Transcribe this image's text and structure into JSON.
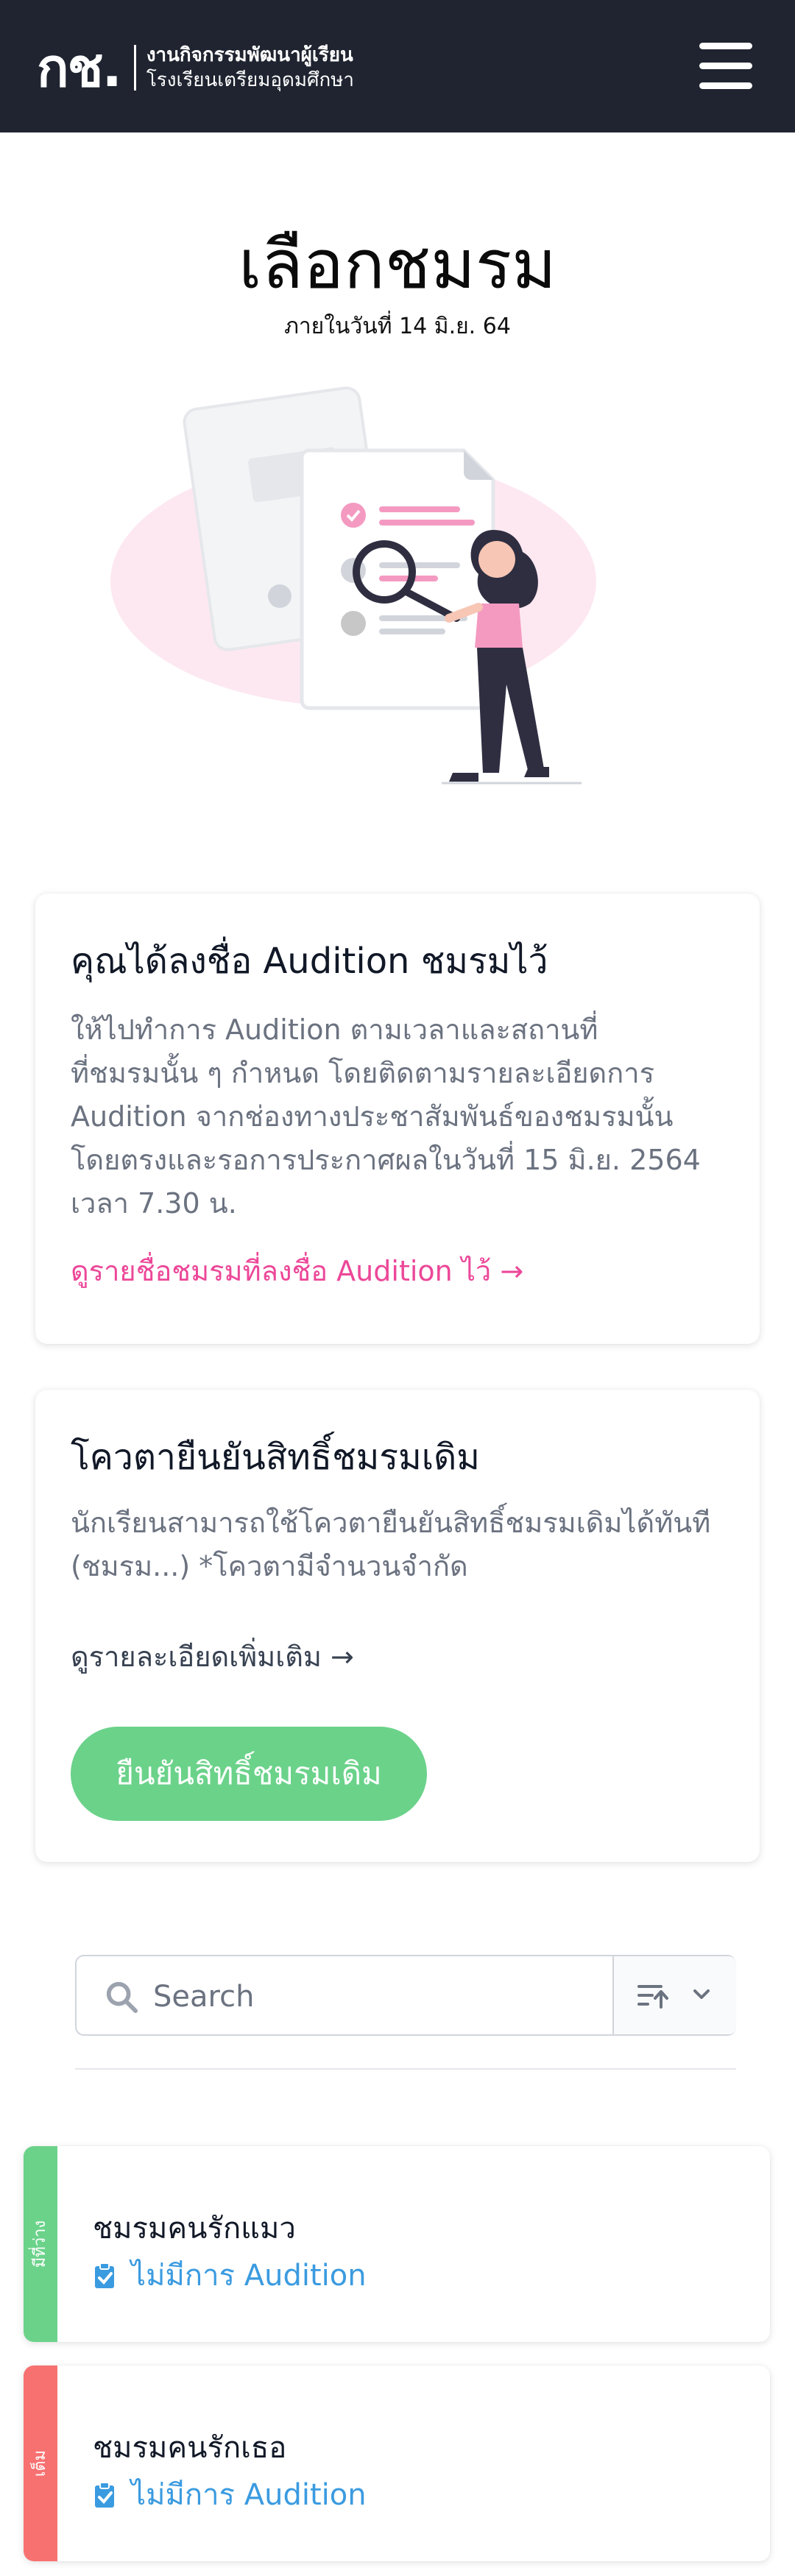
{
  "header": {
    "logo_mark": "กช.",
    "logo_line1": "งานกิจกรรมพัฒนาผู้เรียน",
    "logo_line2": "โรงเรียนเตรียมอุดมศึกษา"
  },
  "hero": {
    "title": "เลือกชมรม",
    "subtitle": "ภายในวันที่ 14 มิ.ย. 64"
  },
  "audition_card": {
    "title": "คุณได้ลงชื่อ Audition ชมรมไว้",
    "body_lines": [
      "ให้ไปทำการ Audition ตามเวลาและสถานที่",
      "ที่ชมรมนั้น ๆ กำหนด โดยติดตามรายละเอียดการ",
      "Audition จากช่องทางประชาสัมพันธ์ของชมรมนั้น",
      "โดยตรงและรอการประกาศผลในวันที่ 15 มิ.ย. 2564",
      "เวลา 7.30 น."
    ],
    "link": "ดูรายชื่อชมรมที่ลงชื่อ Audition ไว้ →"
  },
  "quota_card": {
    "title": "โควตายืนยันสิทธิ์ชมรมเดิม",
    "body_lines": [
      "นักเรียนสามารถใช้โควตายืนยันสิทธิ์ชมรมเดิมได้ทันที",
      "(ชมรม...) *โควตามีจำนวนจำกัด"
    ],
    "link": "ดูรายละเอียดเพิ่มเติม →",
    "button": "ยืนยันสิทธิ์ชมรมเดิม"
  },
  "search": {
    "placeholder": "Search"
  },
  "clubs": [
    {
      "tag": "มีที่ว่าง",
      "name": "ชมรมคนรักแมว",
      "status": "ไม่มีการ Audition",
      "tag_color": "#6bd28a"
    },
    {
      "tag": "เต็ม",
      "name": "ชมรมคนรักเธอ",
      "status": "ไม่มีการ Audition",
      "tag_color": "#f87171"
    }
  ],
  "colors": {
    "header_bg": "#1f2430",
    "accent_pink": "#ec4899",
    "accent_green": "#6bd28a",
    "status_blue": "#3b9be0"
  }
}
